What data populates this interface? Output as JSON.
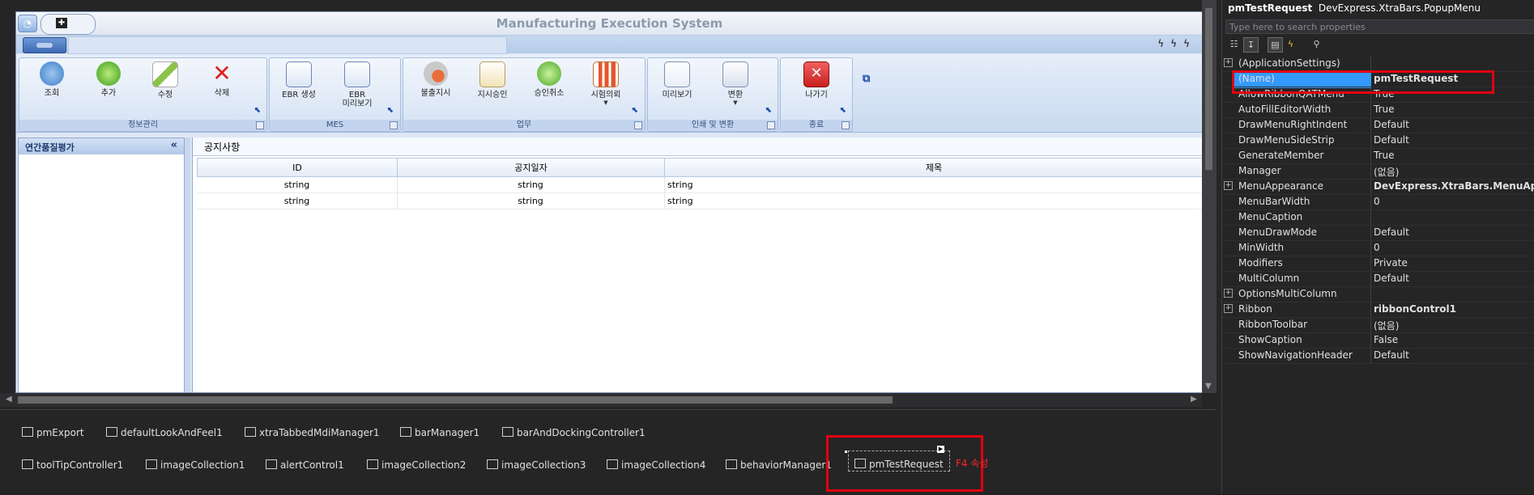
{
  "app": {
    "title": "Manufacturing Execution System"
  },
  "ribbon": {
    "groups": [
      {
        "caption": "정보관리",
        "buttons": [
          "조회",
          "추가",
          "수정",
          "삭제"
        ]
      },
      {
        "caption": "MES",
        "buttons": [
          "EBR 생성",
          "EBR\n미리보기"
        ]
      },
      {
        "caption": "업무",
        "buttons": [
          "불출지시",
          "지시승인",
          "승인취소",
          "시험의뢰"
        ]
      },
      {
        "caption": "인쇄 및 변환",
        "buttons": [
          "미리보기",
          "변환"
        ]
      },
      {
        "caption": "종료",
        "buttons": [
          "나가기"
        ]
      }
    ]
  },
  "nav": {
    "title": "연간품질평가",
    "collapse": "«"
  },
  "notice": {
    "title": "공지사항",
    "columns": [
      "ID",
      "공지일자",
      "제목"
    ],
    "rows": [
      [
        "string",
        "string",
        "string"
      ],
      [
        "string",
        "string",
        "string"
      ]
    ]
  },
  "tray": {
    "row1": [
      "pmExport",
      "defaultLookAndFeel1",
      "xtraTabbedMdiManager1",
      "barManager1",
      "barAndDockingController1"
    ],
    "row2": [
      "toolTipController1",
      "imageCollection1",
      "alertControl1",
      "imageCollection2",
      "imageCollection3",
      "imageCollection4",
      "behaviorManager1"
    ],
    "selected": "pmTestRequest",
    "note": "F4 속성"
  },
  "props": {
    "object_name": "pmTestRequest",
    "object_type": "DevExpress.XtraBars.PopupMenu",
    "search_placeholder": "Type here to search properties",
    "rows": [
      {
        "name": "(ApplicationSettings)",
        "value": "",
        "expand": true
      },
      {
        "name": "(Name)",
        "value": "pmTestRequest",
        "bold": true
      },
      {
        "name": "AllowRibbonQATMenu",
        "value": "True"
      },
      {
        "name": "AutoFillEditorWidth",
        "value": "True"
      },
      {
        "name": "DrawMenuRightIndent",
        "value": "Default"
      },
      {
        "name": "DrawMenuSideStrip",
        "value": "Default"
      },
      {
        "name": "GenerateMember",
        "value": "True"
      },
      {
        "name": "Manager",
        "value": "(없음)"
      },
      {
        "name": "MenuAppearance",
        "value": "DevExpress.XtraBars.MenuAppea",
        "bold": true,
        "expand": true
      },
      {
        "name": "MenuBarWidth",
        "value": "0"
      },
      {
        "name": "MenuCaption",
        "value": ""
      },
      {
        "name": "MenuDrawMode",
        "value": "Default"
      },
      {
        "name": "MinWidth",
        "value": "0"
      },
      {
        "name": "Modifiers",
        "value": "Private"
      },
      {
        "name": "MultiColumn",
        "value": "Default"
      },
      {
        "name": "OptionsMultiColumn",
        "value": "",
        "expand": true
      },
      {
        "name": "Ribbon",
        "value": "ribbonControl1",
        "bold": true,
        "expand": true
      },
      {
        "name": "RibbonToolbar",
        "value": "(없음)"
      },
      {
        "name": "ShowCaption",
        "value": "False"
      },
      {
        "name": "ShowNavigationHeader",
        "value": "Default"
      }
    ]
  },
  "colors": {
    "highlight": "#e3000f",
    "selection": "#3399ff",
    "accent_blue": "#3c6ab4"
  }
}
